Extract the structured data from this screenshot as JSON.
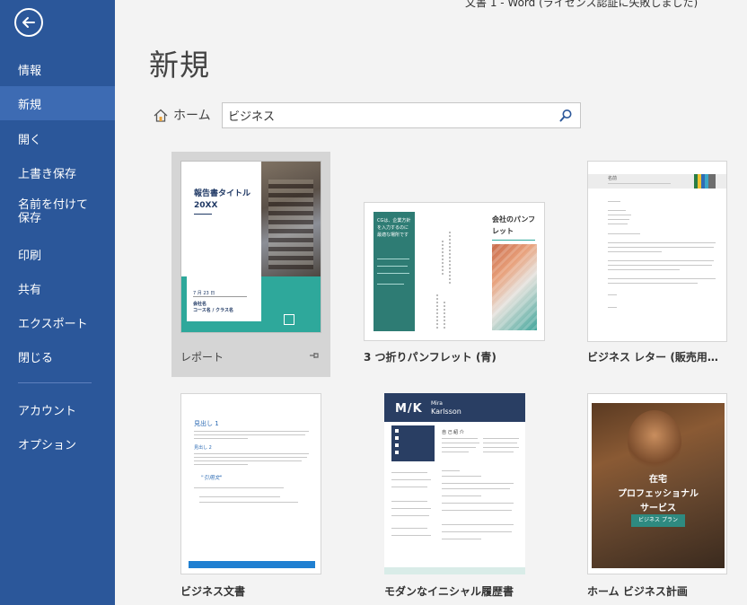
{
  "window": {
    "title": "文書 1 - Word (ライセンス認証に失敗しました)"
  },
  "sidebar": {
    "items": [
      {
        "label": "情報"
      },
      {
        "label": "新規"
      },
      {
        "label": "開く"
      },
      {
        "label": "上書き保存"
      },
      {
        "label": "名前を付けて保存"
      },
      {
        "label": "印刷"
      },
      {
        "label": "共有"
      },
      {
        "label": "エクスポート"
      },
      {
        "label": "閉じる"
      },
      {
        "label": "アカウント"
      },
      {
        "label": "オプション"
      }
    ],
    "selected": "新規"
  },
  "main": {
    "title": "新規",
    "home_label": "ホーム",
    "search": {
      "value": "ビジネス"
    }
  },
  "templates": [
    {
      "caption": "レポート",
      "thumb": {
        "title": "報告書タイトル",
        "year": "20XX",
        "date": "7 月 23 日",
        "line1": "会社名",
        "line2": "コース名 / クラス名"
      }
    },
    {
      "caption": "3 つ折りパンフレット (青)",
      "thumb": {
        "title": "会社のパンフレット",
        "lead": "CGは、企業方針を入力するのに最適な場所です"
      }
    },
    {
      "caption": "ビジネス レター (販売用…",
      "thumb": {
        "name": "名前"
      }
    },
    {
      "caption": "ビジネス文書",
      "thumb": {
        "heading1": "見出し 1",
        "heading2": "見出し 2",
        "quote": "\"引用文\""
      }
    },
    {
      "caption": "モダンなイニシャル履歴書",
      "thumb": {
        "initials": "M/K",
        "first": "Mira",
        "last": "Karlsson",
        "section": "自 己 紹 介"
      }
    },
    {
      "caption": "ホーム ビジネス計画",
      "thumb": {
        "line1": "在宅",
        "line2": "プロフェッショナル",
        "line3": "サービス",
        "badge": "ビジネス プラン"
      }
    }
  ],
  "colors": {
    "sidebar": "#2b579a",
    "selected_nav": "#3d6bb3",
    "teal": "#2ea89b",
    "navy": "#1f3864",
    "resume_header": "#293e63",
    "accent_blue": "#2f6db5"
  }
}
